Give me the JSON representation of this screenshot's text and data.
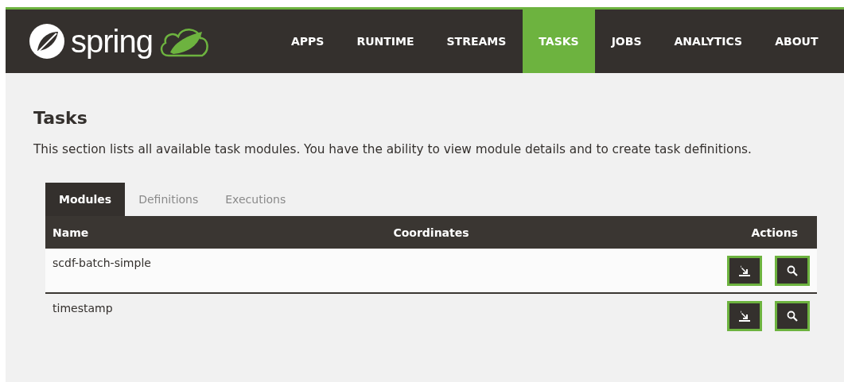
{
  "header": {
    "logo_text": "spring",
    "nav": [
      {
        "label": "APPS",
        "selected": false
      },
      {
        "label": "RUNTIME",
        "selected": false
      },
      {
        "label": "STREAMS",
        "selected": false
      },
      {
        "label": "TASKS",
        "selected": true
      },
      {
        "label": "JOBS",
        "selected": false
      },
      {
        "label": "ANALYTICS",
        "selected": false
      },
      {
        "label": "ABOUT",
        "selected": false
      }
    ]
  },
  "page": {
    "title": "Tasks",
    "description": "This section lists all available task modules. You have the ability to view module details and to create task definitions."
  },
  "tabs": [
    {
      "label": "Modules",
      "selected": true
    },
    {
      "label": "Definitions",
      "selected": false
    },
    {
      "label": "Executions",
      "selected": false
    }
  ],
  "table": {
    "columns": [
      "Name",
      "Coordinates",
      "Actions"
    ],
    "rows": [
      {
        "name": "scdf-batch-simple",
        "highlighted": true
      },
      {
        "name": "timestamp",
        "highlighted": false
      }
    ]
  }
}
